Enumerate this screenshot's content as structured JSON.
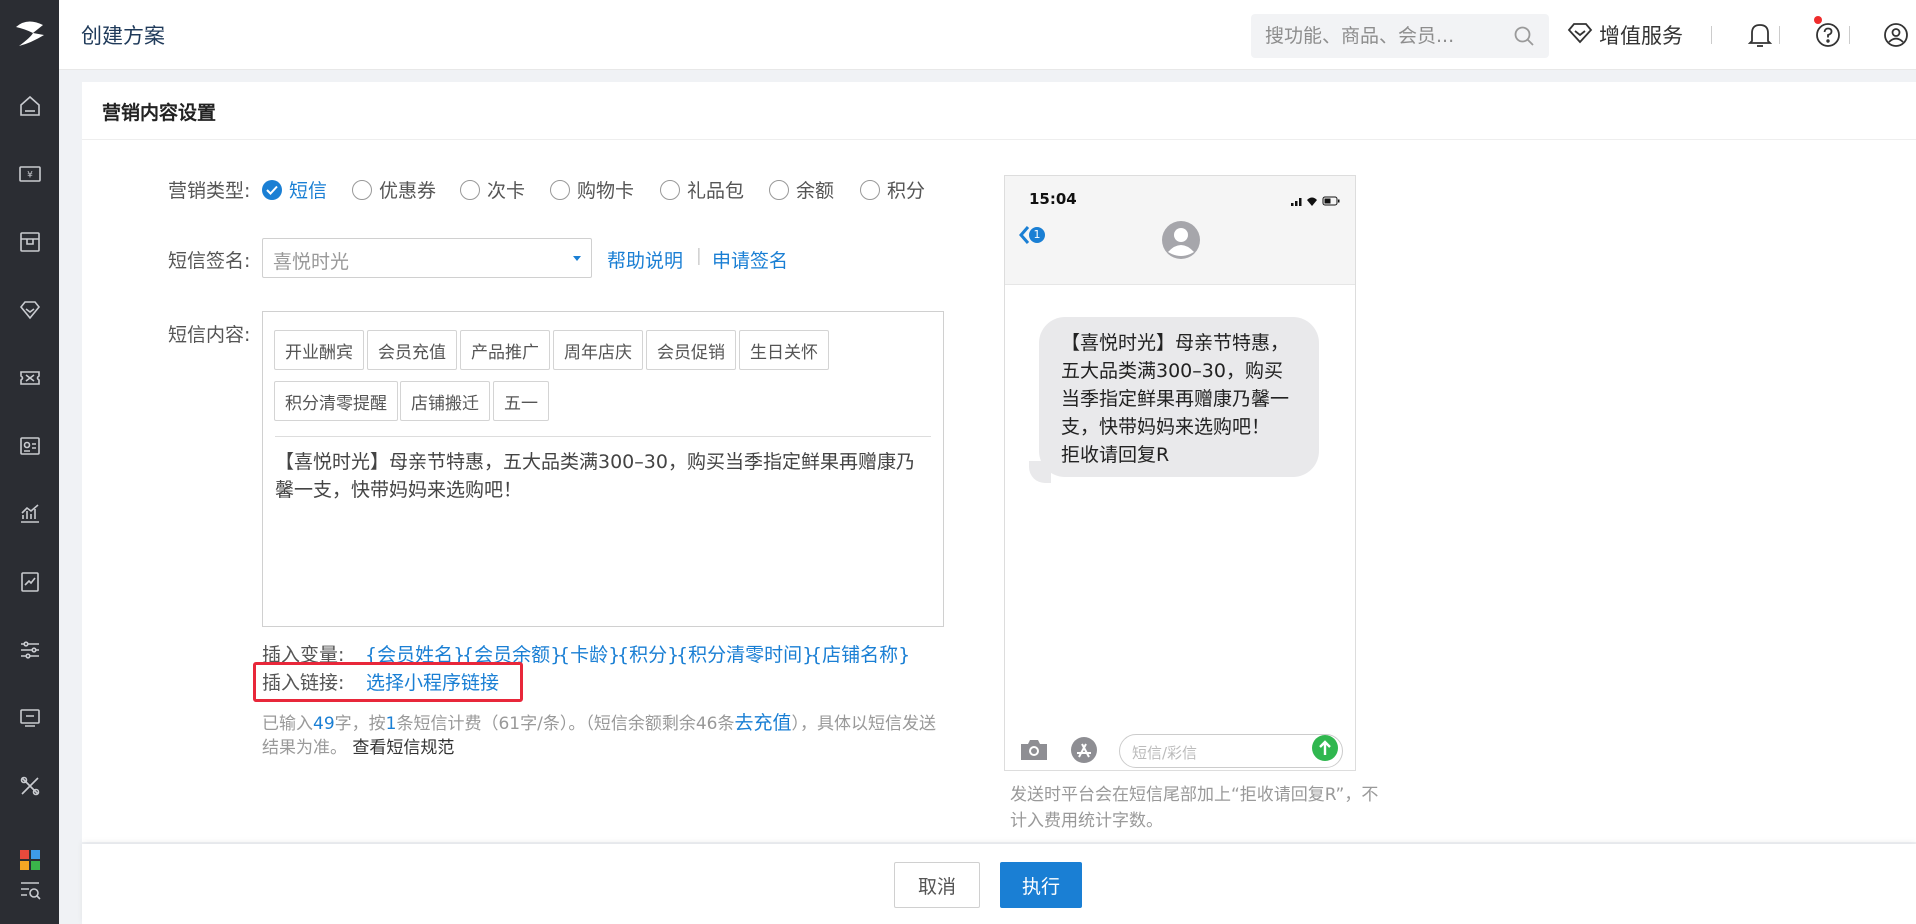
{
  "header": {
    "title": "创建方案",
    "search_placeholder": "搜功能、商品、会员...",
    "vip_label": "增值服务"
  },
  "section": {
    "title": "营销内容设置"
  },
  "marketing_type": {
    "label": "营销类型:",
    "options": [
      "短信",
      "优惠券",
      "次卡",
      "购物卡",
      "礼品包",
      "余额",
      "积分"
    ],
    "selected": "短信"
  },
  "signature": {
    "label": "短信签名:",
    "value": "喜悦时光",
    "help_link": "帮助说明",
    "separator": "|",
    "apply_link": "申请签名"
  },
  "content": {
    "label": "短信内容:",
    "templates": [
      "开业酬宾",
      "会员充值",
      "产品推广",
      "周年店庆",
      "会员促销",
      "生日关怀",
      "积分清零提醒",
      "店铺搬迁",
      "五一"
    ],
    "text": "【喜悦时光】母亲节特惠，五大品类满300–30，购买当季指定鲜果再赠康乃馨一支，快带妈妈来选购吧！"
  },
  "insert_var": {
    "label": "插入变量:",
    "vars": [
      "{会员姓名}",
      "{会员余额}",
      "{卡龄}",
      "{积分}",
      "{积分清零时间}",
      "{店铺名称}"
    ]
  },
  "insert_link": {
    "label": "插入链接:",
    "link": "选择小程序链接"
  },
  "count": {
    "p1": "已输入",
    "chars": "49",
    "p2": "字，按",
    "msgs": "1",
    "p3": "条短信计费（61字/条）。（短信余额剩余46条",
    "recharge": "去充值",
    "p4": "），具体以短信发送结果为准。",
    "spec": "查看短信规范"
  },
  "phone": {
    "time": "15:04",
    "badge": "1",
    "bubble_lines": [
      "【喜悦时光】母亲节特惠，",
      "五大品类满300–30，购买",
      "当季指定鲜果再赠康乃馨一",
      "支，快带妈妈来选购吧！",
      "拒收请回复R"
    ],
    "input_placeholder": "短信/彩信",
    "note": "发送时平台会在短信尾部加上“拒收请回复R”，不计入费用统计字数。"
  },
  "footer": {
    "cancel": "取消",
    "execute": "执行"
  },
  "colors": {
    "accent": "#1a7fd4",
    "sidebar_bg": "#2b2d33",
    "highlight": "#e8273a"
  }
}
